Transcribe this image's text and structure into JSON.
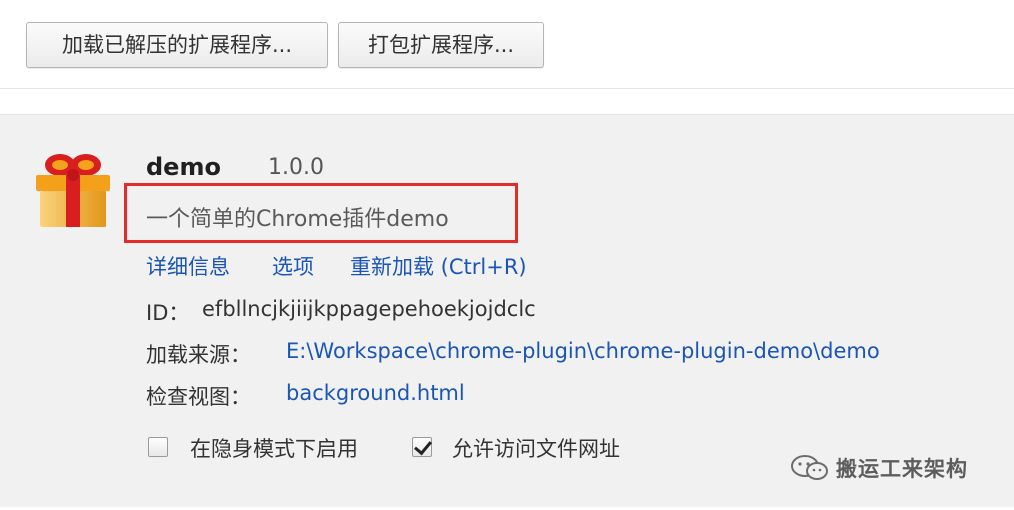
{
  "toolbar": {
    "load_unpacked_label": "加载已解压的扩展程序...",
    "pack_label": "打包扩展程序..."
  },
  "extension": {
    "icon": "gift-box-icon",
    "name": "demo",
    "version": "1.0.0",
    "description": "一个简单的Chrome插件demo",
    "links": {
      "details": "详细信息",
      "options": "选项",
      "reload": "重新加载 (Ctrl+R)"
    },
    "id_label": "ID：",
    "id_value": "efbllncjkjiijkppagepehoekjojdclc",
    "source_label": "加载来源：",
    "source_value": "E:\\Workspace\\chrome-plugin\\chrome-plugin-demo\\demo",
    "views_label": "检查视图：",
    "views_value": "background.html",
    "incognito": {
      "label": "在隐身模式下启用",
      "checked": false
    },
    "file_access": {
      "label": "允许访问文件网址",
      "checked": true
    }
  },
  "watermark": {
    "icon": "wechat-icon",
    "text": "搬运工来架构"
  },
  "colors": {
    "highlight": "#e32b2b",
    "link": "#1a55b8",
    "panel_bg": "#f1f1f1"
  }
}
